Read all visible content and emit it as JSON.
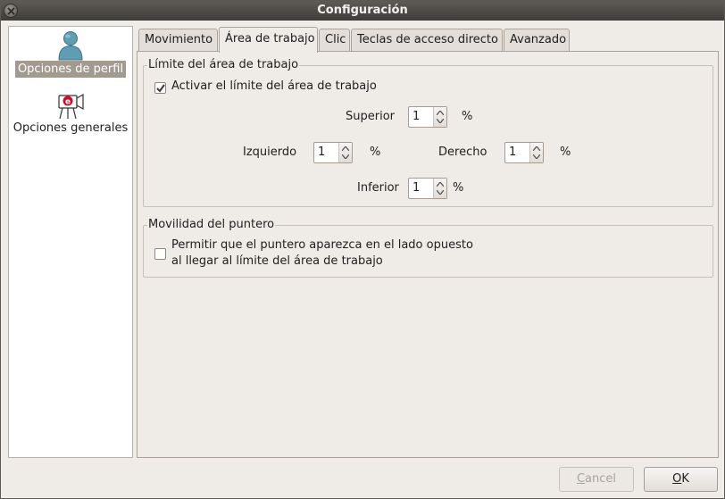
{
  "window": {
    "title": "Configuración"
  },
  "sidebar": {
    "items": [
      {
        "label": "Opciones de perfil",
        "icon": "user-profile-icon",
        "selected": true
      },
      {
        "label": "Opciones generales",
        "icon": "camera-icon",
        "selected": false
      }
    ]
  },
  "tabs": [
    {
      "label": "Movimiento",
      "active": false
    },
    {
      "label": "Área de trabajo",
      "active": true
    },
    {
      "label": "Clic",
      "active": false
    },
    {
      "label": "Teclas de acceso directo",
      "active": false
    },
    {
      "label": "Avanzado",
      "active": false
    }
  ],
  "workspace": {
    "frame_title": "Límite del área de trabajo",
    "enable_label": "Activar el límite del área de trabajo",
    "enable_checked": true,
    "top": {
      "label": "Superior",
      "value": "1",
      "unit": "%"
    },
    "left": {
      "label": "Izquierdo",
      "value": "1",
      "unit": "%"
    },
    "right": {
      "label": "Derecho",
      "value": "1",
      "unit": "%"
    },
    "bottom": {
      "label": "Inferior",
      "value": "1",
      "unit": "%"
    }
  },
  "pointer": {
    "frame_title": "Movilidad del puntero",
    "wrap_label_line1": "Permitir que el puntero aparezca en el lado opuesto",
    "wrap_label_line2": "al llegar al límite del área de trabajo",
    "wrap_checked": false
  },
  "buttons": {
    "cancel_label": "Cancel",
    "cancel_mnemonic": "C",
    "cancel_rest": "ancel",
    "ok_label": "OK",
    "ok_mnemonic": "O",
    "ok_rest": "K"
  },
  "colors": {
    "titlebar": "#4a4844",
    "selection": "#a39a8f",
    "window_bg": "#efebe7"
  }
}
